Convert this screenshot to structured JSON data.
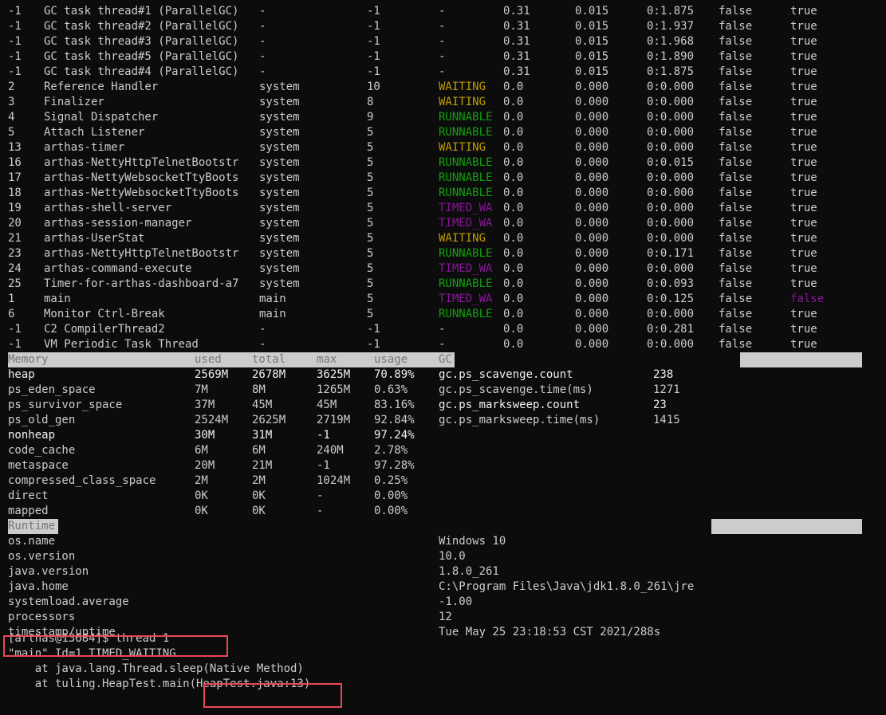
{
  "threads": [
    {
      "id": "-1",
      "name": "GC task thread#1 (ParallelGC)",
      "group": "-",
      "priority": "-1",
      "state": "-",
      "cpu": "0.31",
      "delta": "0.015",
      "time": "0:1.875",
      "interrupted": "false",
      "daemon": "true",
      "state_color": "",
      "daemon_color": ""
    },
    {
      "id": "-1",
      "name": "GC task thread#2 (ParallelGC)",
      "group": "-",
      "priority": "-1",
      "state": "-",
      "cpu": "0.31",
      "delta": "0.015",
      "time": "0:1.937",
      "interrupted": "false",
      "daemon": "true",
      "state_color": "",
      "daemon_color": ""
    },
    {
      "id": "-1",
      "name": "GC task thread#3 (ParallelGC)",
      "group": "-",
      "priority": "-1",
      "state": "-",
      "cpu": "0.31",
      "delta": "0.015",
      "time": "0:1.968",
      "interrupted": "false",
      "daemon": "true",
      "state_color": "",
      "daemon_color": ""
    },
    {
      "id": "-1",
      "name": "GC task thread#5 (ParallelGC)",
      "group": "-",
      "priority": "-1",
      "state": "-",
      "cpu": "0.31",
      "delta": "0.015",
      "time": "0:1.890",
      "interrupted": "false",
      "daemon": "true",
      "state_color": "",
      "daemon_color": ""
    },
    {
      "id": "-1",
      "name": "GC task thread#4 (ParallelGC)",
      "group": "-",
      "priority": "-1",
      "state": "-",
      "cpu": "0.31",
      "delta": "0.015",
      "time": "0:1.875",
      "interrupted": "false",
      "daemon": "true",
      "state_color": "",
      "daemon_color": ""
    },
    {
      "id": "2",
      "name": "Reference Handler",
      "group": "system",
      "priority": "10",
      "state": "WAITING",
      "cpu": "0.0",
      "delta": "0.000",
      "time": "0:0.000",
      "interrupted": "false",
      "daemon": "true",
      "state_color": "waiting",
      "daemon_color": ""
    },
    {
      "id": "3",
      "name": "Finalizer",
      "group": "system",
      "priority": "8",
      "state": "WAITING",
      "cpu": "0.0",
      "delta": "0.000",
      "time": "0:0.000",
      "interrupted": "false",
      "daemon": "true",
      "state_color": "waiting",
      "daemon_color": ""
    },
    {
      "id": "4",
      "name": "Signal Dispatcher",
      "group": "system",
      "priority": "9",
      "state": "RUNNABLE",
      "cpu": "0.0",
      "delta": "0.000",
      "time": "0:0.000",
      "interrupted": "false",
      "daemon": "true",
      "state_color": "runnable",
      "daemon_color": ""
    },
    {
      "id": "5",
      "name": "Attach Listener",
      "group": "system",
      "priority": "5",
      "state": "RUNNABLE",
      "cpu": "0.0",
      "delta": "0.000",
      "time": "0:0.000",
      "interrupted": "false",
      "daemon": "true",
      "state_color": "runnable",
      "daemon_color": ""
    },
    {
      "id": "13",
      "name": "arthas-timer",
      "group": "system",
      "priority": "5",
      "state": "WAITING",
      "cpu": "0.0",
      "delta": "0.000",
      "time": "0:0.000",
      "interrupted": "false",
      "daemon": "true",
      "state_color": "waiting",
      "daemon_color": ""
    },
    {
      "id": "16",
      "name": "arthas-NettyHttpTelnetBootstr",
      "group": "system",
      "priority": "5",
      "state": "RUNNABLE",
      "cpu": "0.0",
      "delta": "0.000",
      "time": "0:0.015",
      "interrupted": "false",
      "daemon": "true",
      "state_color": "runnable",
      "daemon_color": ""
    },
    {
      "id": "17",
      "name": "arthas-NettyWebsocketTtyBoots",
      "group": "system",
      "priority": "5",
      "state": "RUNNABLE",
      "cpu": "0.0",
      "delta": "0.000",
      "time": "0:0.000",
      "interrupted": "false",
      "daemon": "true",
      "state_color": "runnable",
      "daemon_color": ""
    },
    {
      "id": "18",
      "name": "arthas-NettyWebsocketTtyBoots",
      "group": "system",
      "priority": "5",
      "state": "RUNNABLE",
      "cpu": "0.0",
      "delta": "0.000",
      "time": "0:0.000",
      "interrupted": "false",
      "daemon": "true",
      "state_color": "runnable",
      "daemon_color": ""
    },
    {
      "id": "19",
      "name": "arthas-shell-server",
      "group": "system",
      "priority": "5",
      "state": "TIMED_WA",
      "cpu": "0.0",
      "delta": "0.000",
      "time": "0:0.000",
      "interrupted": "false",
      "daemon": "true",
      "state_color": "timed",
      "daemon_color": ""
    },
    {
      "id": "20",
      "name": "arthas-session-manager",
      "group": "system",
      "priority": "5",
      "state": "TIMED_WA",
      "cpu": "0.0",
      "delta": "0.000",
      "time": "0:0.000",
      "interrupted": "false",
      "daemon": "true",
      "state_color": "timed",
      "daemon_color": ""
    },
    {
      "id": "21",
      "name": "arthas-UserStat",
      "group": "system",
      "priority": "5",
      "state": "WAITING",
      "cpu": "0.0",
      "delta": "0.000",
      "time": "0:0.000",
      "interrupted": "false",
      "daemon": "true",
      "state_color": "waiting",
      "daemon_color": ""
    },
    {
      "id": "23",
      "name": "arthas-NettyHttpTelnetBootstr",
      "group": "system",
      "priority": "5",
      "state": "RUNNABLE",
      "cpu": "0.0",
      "delta": "0.000",
      "time": "0:0.171",
      "interrupted": "false",
      "daemon": "true",
      "state_color": "runnable",
      "daemon_color": ""
    },
    {
      "id": "24",
      "name": "arthas-command-execute",
      "group": "system",
      "priority": "5",
      "state": "TIMED_WA",
      "cpu": "0.0",
      "delta": "0.000",
      "time": "0:0.000",
      "interrupted": "false",
      "daemon": "true",
      "state_color": "timed",
      "daemon_color": ""
    },
    {
      "id": "25",
      "name": "Timer-for-arthas-dashboard-a7",
      "group": "system",
      "priority": "5",
      "state": "RUNNABLE",
      "cpu": "0.0",
      "delta": "0.000",
      "time": "0:0.093",
      "interrupted": "false",
      "daemon": "true",
      "state_color": "runnable",
      "daemon_color": ""
    },
    {
      "id": "1",
      "name": "main",
      "group": "main",
      "priority": "5",
      "state": "TIMED_WA",
      "cpu": "0.0",
      "delta": "0.000",
      "time": "0:0.125",
      "interrupted": "false",
      "daemon": "false",
      "state_color": "timed",
      "daemon_color": "purple"
    },
    {
      "id": "6",
      "name": "Monitor Ctrl-Break",
      "group": "main",
      "priority": "5",
      "state": "RUNNABLE",
      "cpu": "0.0",
      "delta": "0.000",
      "time": "0:0.000",
      "interrupted": "false",
      "daemon": "true",
      "state_color": "runnable",
      "daemon_color": ""
    },
    {
      "id": "-1",
      "name": "C2 CompilerThread2",
      "group": "-",
      "priority": "-1",
      "state": "-",
      "cpu": "0.0",
      "delta": "0.000",
      "time": "0:0.281",
      "interrupted": "false",
      "daemon": "true",
      "state_color": "",
      "daemon_color": ""
    },
    {
      "id": "-1",
      "name": "VM Periodic Task Thread",
      "group": "-",
      "priority": "-1",
      "state": "-",
      "cpu": "0.0",
      "delta": "0.000",
      "time": "0:0.000",
      "interrupted": "false",
      "daemon": "true",
      "state_color": "",
      "daemon_color": ""
    }
  ],
  "memory": {
    "headers": {
      "name": "Memory",
      "used": "used",
      "total": "total",
      "max": "max",
      "usage": "usage",
      "gc": "GC"
    },
    "rows": [
      {
        "name": "heap",
        "used": "2569M",
        "total": "2678M",
        "max": "3625M",
        "usage": "70.89%",
        "bold": true
      },
      {
        "name": "ps_eden_space",
        "used": "7M",
        "total": "8M",
        "max": "1265M",
        "usage": "0.63%",
        "bold": false
      },
      {
        "name": "ps_survivor_space",
        "used": "37M",
        "total": "45M",
        "max": "45M",
        "usage": "83.16%",
        "bold": false
      },
      {
        "name": "ps_old_gen",
        "used": "2524M",
        "total": "2625M",
        "max": "2719M",
        "usage": "92.84%",
        "bold": false
      },
      {
        "name": "nonheap",
        "used": "30M",
        "total": "31M",
        "max": "-1",
        "usage": "97.24%",
        "bold": true
      },
      {
        "name": "code_cache",
        "used": "6M",
        "total": "6M",
        "max": "240M",
        "usage": "2.78%",
        "bold": false
      },
      {
        "name": "metaspace",
        "used": "20M",
        "total": "21M",
        "max": "-1",
        "usage": "97.28%",
        "bold": false
      },
      {
        "name": "compressed_class_space",
        "used": "2M",
        "total": "2M",
        "max": "1024M",
        "usage": "0.25%",
        "bold": false
      },
      {
        "name": "direct",
        "used": "0K",
        "total": "0K",
        "max": "-",
        "usage": "0.00%",
        "bold": false
      },
      {
        "name": "mapped",
        "used": "0K",
        "total": "0K",
        "max": "-",
        "usage": "0.00%",
        "bold": false
      }
    ],
    "gc": [
      {
        "name": "gc.ps_scavenge.count",
        "value": "238",
        "bold": true
      },
      {
        "name": "gc.ps_scavenge.time(ms)",
        "value": "1271",
        "bold": false
      },
      {
        "name": "gc.ps_marksweep.count",
        "value": "23",
        "bold": true
      },
      {
        "name": "gc.ps_marksweep.time(ms)",
        "value": "1415",
        "bold": false
      }
    ]
  },
  "runtime": {
    "header": "Runtime",
    "rows": [
      {
        "key": "os.name",
        "value": "Windows 10"
      },
      {
        "key": "os.version",
        "value": "10.0"
      },
      {
        "key": "java.version",
        "value": "1.8.0_261"
      },
      {
        "key": "java.home",
        "value": "C:\\Program Files\\Java\\jdk1.8.0_261\\jre"
      },
      {
        "key": "systemload.average",
        "value": "-1.00"
      },
      {
        "key": "processors",
        "value": "12"
      },
      {
        "key": "timestamp/uptime",
        "value": "Tue May 25 23:18:53 CST 2021/288s"
      }
    ]
  },
  "console": {
    "prompt": "[arthas@13684]$ thread 1",
    "thread_header": "\"main\" Id=1 TIMED_WAITING",
    "stack": [
      "    at java.lang.Thread.sleep(Native Method)",
      "    at tuling.HeapTest.main(HeapTest.java:13)"
    ]
  },
  "colors": {
    "background": "#0c0c0c",
    "text": "#cccccc",
    "waiting": "#c19c00",
    "runnable": "#13a10e",
    "timed_waiting": "#881798",
    "highlight_box": "#e74856"
  }
}
